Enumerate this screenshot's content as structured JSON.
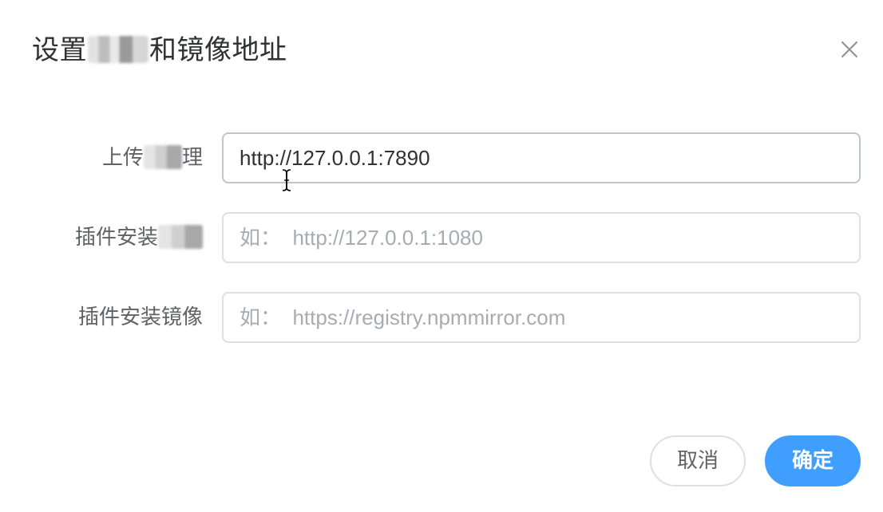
{
  "dialog": {
    "title_prefix": "设置",
    "title_suffix": "和镜像地址",
    "close_icon": "close-icon"
  },
  "form": {
    "rows": [
      {
        "label_prefix": "上传",
        "label_suffix": "理",
        "value": "http://127.0.0.1:7890",
        "placeholder": ""
      },
      {
        "label_prefix": "插件安装",
        "label_suffix": "",
        "value": "",
        "placeholder": "如：  http://127.0.0.1:1080"
      },
      {
        "label_prefix": "插件安装镜像",
        "label_suffix": "",
        "value": "",
        "placeholder": "如：  https://registry.npmmirror.com"
      }
    ]
  },
  "footer": {
    "cancel_label": "取消",
    "confirm_label": "确定"
  },
  "colors": {
    "primary": "#409eff",
    "border": "#dcdfe6",
    "placeholder": "#a8abb2",
    "text": "#303133"
  }
}
